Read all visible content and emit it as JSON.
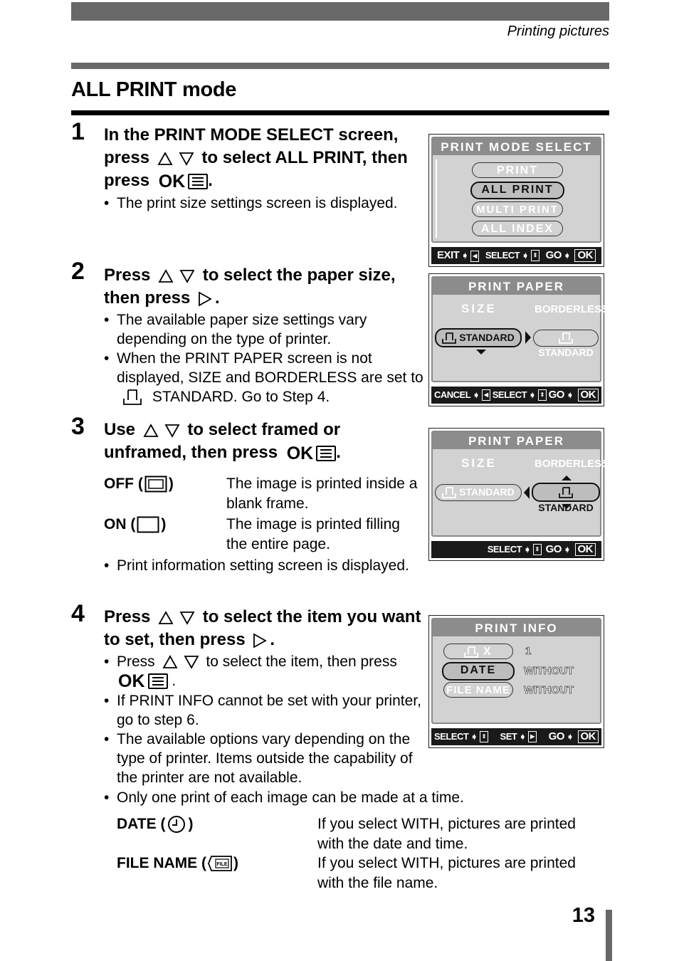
{
  "header": {
    "section": "Printing pictures",
    "title": "ALL PRINT mode"
  },
  "steps": [
    {
      "number": "1",
      "heading_parts": [
        "In the PRINT MODE SELECT screen, press",
        "to select ALL PRINT, then press",
        "."
      ],
      "bullets": [
        "The print size settings screen is displayed."
      ]
    },
    {
      "number": "2",
      "heading_parts": [
        "Press",
        "to select the paper size, then press",
        "."
      ],
      "bullets": [
        "The available paper size settings vary depending on the type of printer.",
        "When the PRINT PAPER screen is not displayed, SIZE and BORDERLESS are set to",
        "STANDARD. Go to Step 4."
      ]
    },
    {
      "number": "3",
      "heading_parts": [
        "Use",
        "to select framed or unframed, then press",
        "."
      ],
      "definitions": [
        {
          "term": "OFF (",
          "term_end": ")",
          "icon": "framed-icon",
          "desc": "The image is printed inside a blank frame."
        },
        {
          "term": "ON (",
          "term_end": ")",
          "icon": "unframed-icon",
          "desc": "The image is printed filling the entire page."
        }
      ],
      "bullets": [
        "Print information setting screen is displayed."
      ]
    },
    {
      "number": "4",
      "heading_parts": [
        "Press",
        "to select the item you want to set, then press",
        "."
      ],
      "bullets": [
        "Press",
        "to select the item, then press",
        "If PRINT INFO cannot be set with your printer, go to step 6.",
        "The available options vary depending on the type of printer. Items outside the capability of the printer are not available.",
        "Only one print of each image can be made at a time."
      ],
      "definitions": [
        {
          "term": "DATE (",
          "term_end": ")",
          "icon": "clock-icon",
          "desc": "If you select WITH, pictures are printed with the date and time."
        },
        {
          "term": "FILE NAME (",
          "term_end": ")",
          "icon": "file-icon",
          "desc": "If you select WITH, pictures are printed with the file name."
        }
      ]
    }
  ],
  "ok_label": "OK",
  "screens": {
    "mode_select": {
      "title": "PRINT MODE SELECT",
      "options": [
        "PRINT",
        "ALL PRINT",
        "MULTI PRINT",
        "ALL INDEX"
      ],
      "selected": "ALL PRINT",
      "footer": {
        "exit": "EXIT",
        "select": "SELECT",
        "go": "GO",
        "ok": "OK"
      }
    },
    "paper_size": {
      "title": "PRINT PAPER",
      "size_label": "SIZE",
      "borderless_label": "BORDERLESS",
      "size_value": "STANDARD",
      "borderless_value": "STANDARD",
      "active": "SIZE",
      "footer": {
        "cancel": "CANCEL",
        "select": "SELECT",
        "go": "GO",
        "ok": "OK"
      }
    },
    "paper_borderless": {
      "title": "PRINT PAPER",
      "size_label": "SIZE",
      "borderless_label": "BORDERLESS",
      "size_value": "STANDARD",
      "borderless_value": "STANDARD",
      "active": "BORDERLESS",
      "footer": {
        "select": "SELECT",
        "go": "GO",
        "ok": "OK"
      }
    },
    "print_info": {
      "title": "PRINT INFO",
      "rows": [
        {
          "label": "X",
          "value": "1"
        },
        {
          "label": "DATE",
          "value": "WITHOUT"
        },
        {
          "label": "FILE NAME",
          "value": "WITHOUT"
        }
      ],
      "selected": "DATE",
      "footer": {
        "select": "SELECT",
        "set": "SET",
        "go": "GO",
        "ok": "OK"
      }
    }
  },
  "footer": {
    "page_number": "13"
  },
  "colors": {
    "bar": "#686868",
    "screen_bg": "#d2d2d2",
    "screen_title": "#8c8c8c",
    "screen_footer": "#1a1a1a"
  }
}
